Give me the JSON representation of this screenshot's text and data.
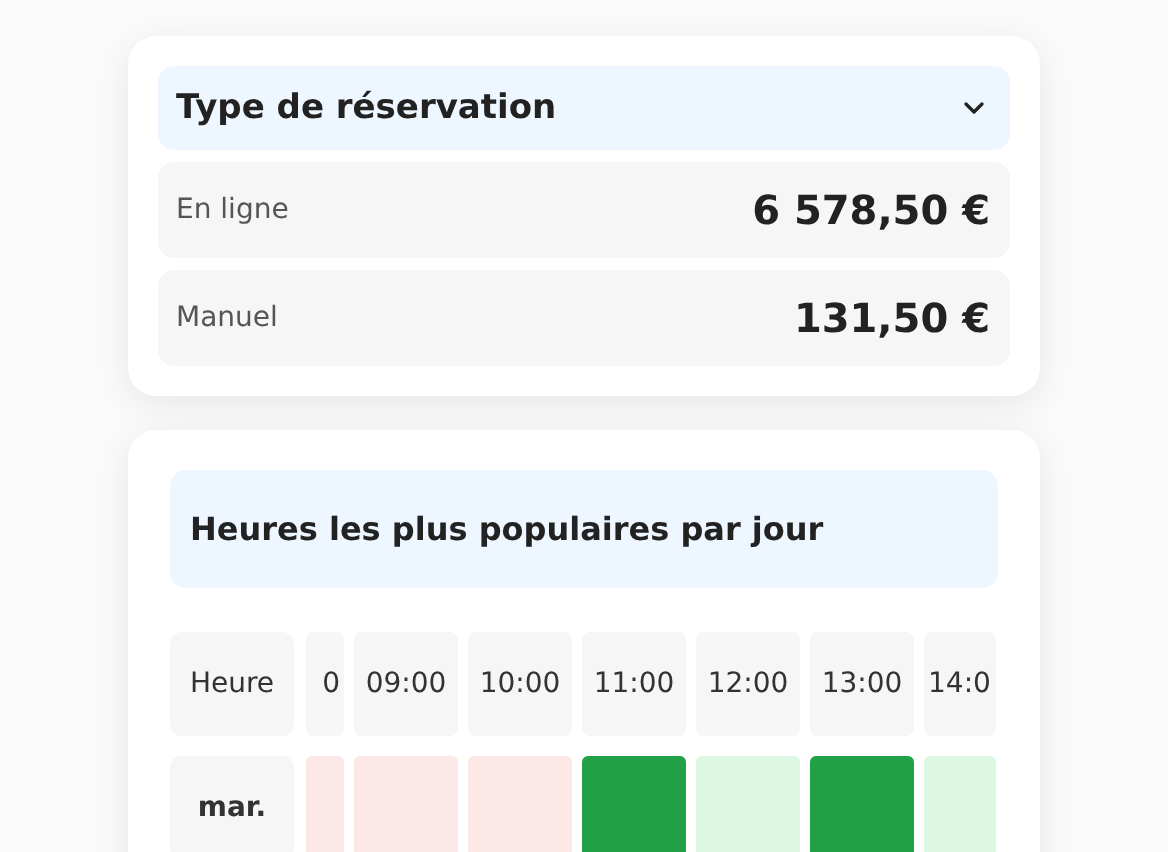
{
  "booking_type_card": {
    "title": "Type de réservation",
    "expanded": true,
    "rows": [
      {
        "label": "En ligne",
        "amount": "6 578,50 €"
      },
      {
        "label": "Manuel",
        "amount": "131,50 €"
      }
    ]
  },
  "popular_hours_card": {
    "title": "Heures les plus populaires par jour",
    "corner_label": "Heure",
    "hours": [
      "0",
      "09:00",
      "10:00",
      "11:00",
      "12:00",
      "13:00",
      "14:0"
    ],
    "days": [
      {
        "label": "mar.",
        "cells": [
          {
            "color": "#fce8e6"
          },
          {
            "color": "#fce8e6"
          },
          {
            "color": "#fce8e6"
          },
          {
            "color": "#22a045"
          },
          {
            "color": "#dcf8e2"
          },
          {
            "color": "#22a045"
          },
          {
            "color": "#dcf8e2"
          }
        ]
      }
    ]
  }
}
